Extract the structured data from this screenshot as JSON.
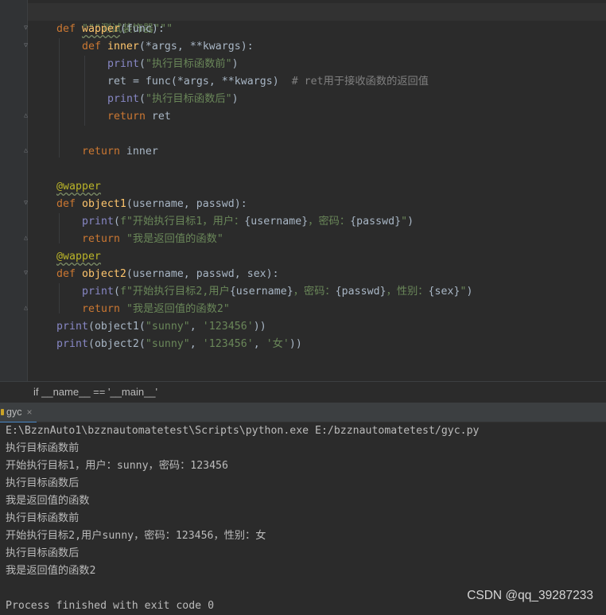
{
  "editor": {
    "docstring": "\"\"\"测试装饰器\"\"\"",
    "code": {
      "def_kw": "def",
      "wapper_name": "wapper",
      "wapper_sig": "(func):",
      "inner_name": "inner",
      "inner_sig": "(*args, **kwargs):",
      "print_fn": "print",
      "str_before": "\"执行目标函数前\"",
      "ret_assign": "ret = func(*args, **kwargs)",
      "ret_comment": "# ret用于接收函数的返回值",
      "str_after": "\"执行目标函数后\"",
      "return_kw": "return",
      "ret_var": " ret",
      "inner_var": " inner",
      "decorator": "@wapper",
      "object1_name": "object1",
      "object1_sig": "(username, passwd):",
      "o1_fstr_a": "f\"开始执行目标1，用户：",
      "o1_fvar_user": "{username}",
      "o1_fstr_b": "，密码：",
      "o1_fvar_pwd": "{passwd}",
      "o1_fstr_c": "\"",
      "o1_return_str": "\"我是返回值的函数\"",
      "object2_name": "object2",
      "object2_sig": "(username, passwd, sex):",
      "o2_fstr_a": "f\"开始执行目标2,用户",
      "o2_fvar_user": "{username}",
      "o2_fstr_b": "，密码：",
      "o2_fvar_pwd": "{passwd}",
      "o2_fstr_c": "，性别：",
      "o2_fvar_sex": "{sex}",
      "o2_fstr_d": "\"",
      "o2_return_str": "\"我是返回值的函数2\"",
      "call1_a": "(object1(",
      "call1_s1": "\"sunny\"",
      "call1_s2": "'123456'",
      "call_close": "))",
      "call2_a": "(object2(",
      "call2_s1": "\"sunny\"",
      "call2_s2": "'123456'",
      "call2_s3": "'女'"
    }
  },
  "breadcrumb": {
    "text": "if __name__ == '__main__'"
  },
  "run_panel": {
    "tab_label": "gyc",
    "tab_close": "×",
    "console_lines": [
      "E:\\BzznAuto1\\bzznautomatetest\\Scripts\\python.exe E:/bzznautomatetest/gyc.py",
      "执行目标函数前",
      "开始执行目标1，用户：sunny，密码：123456",
      "执行目标函数后",
      "我是返回值的函数",
      "执行目标函数前",
      "开始执行目标2,用户sunny，密码：123456，性别：女",
      "执行目标函数后",
      "我是返回值的函数2",
      "",
      "Process finished with exit code 0"
    ]
  },
  "watermark": "CSDN @qq_39287233"
}
